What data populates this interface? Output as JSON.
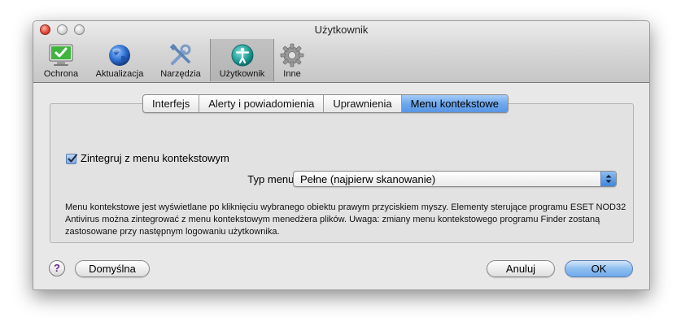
{
  "window": {
    "title": "Użytkownik"
  },
  "toolbar": {
    "items": [
      {
        "label": "Ochrona",
        "icon": "monitor-check-icon"
      },
      {
        "label": "Aktualizacja",
        "icon": "globe-icon"
      },
      {
        "label": "Narzędzia",
        "icon": "tools-icon"
      },
      {
        "label": "Użytkownik",
        "icon": "user-accessibility-icon",
        "selected": true
      },
      {
        "label": "Inne",
        "icon": "gear-icon"
      }
    ]
  },
  "tabs": [
    {
      "label": "Interfejs"
    },
    {
      "label": "Alerty i powiadomienia"
    },
    {
      "label": "Uprawnienia"
    },
    {
      "label": "Menu kontekstowe",
      "active": true
    }
  ],
  "context_menu": {
    "integrate_label": "Zintegruj z menu kontekstowym",
    "integrate_checked": true,
    "menu_type_label": "Typ menu:",
    "menu_type_value": "Pełne (najpierw skanowanie)",
    "description": "Menu kontekstowe jest wyświetlane po kliknięciu wybranego obiektu prawym przyciskiem myszy. Elementy sterujące programu ESET NOD32 Antivirus można zintegrować z menu kontekstowym menedżera plików. Uwaga: zmiany menu kontekstowego programu Finder zostaną zastosowane przy następnym logowaniu użytkownika."
  },
  "footer": {
    "help_label": "?",
    "default_label": "Domyślna",
    "cancel_label": "Anuluj",
    "ok_label": "OK"
  },
  "colors": {
    "accent": "#6fa8ec",
    "window_bg": "#e8e8e8"
  }
}
